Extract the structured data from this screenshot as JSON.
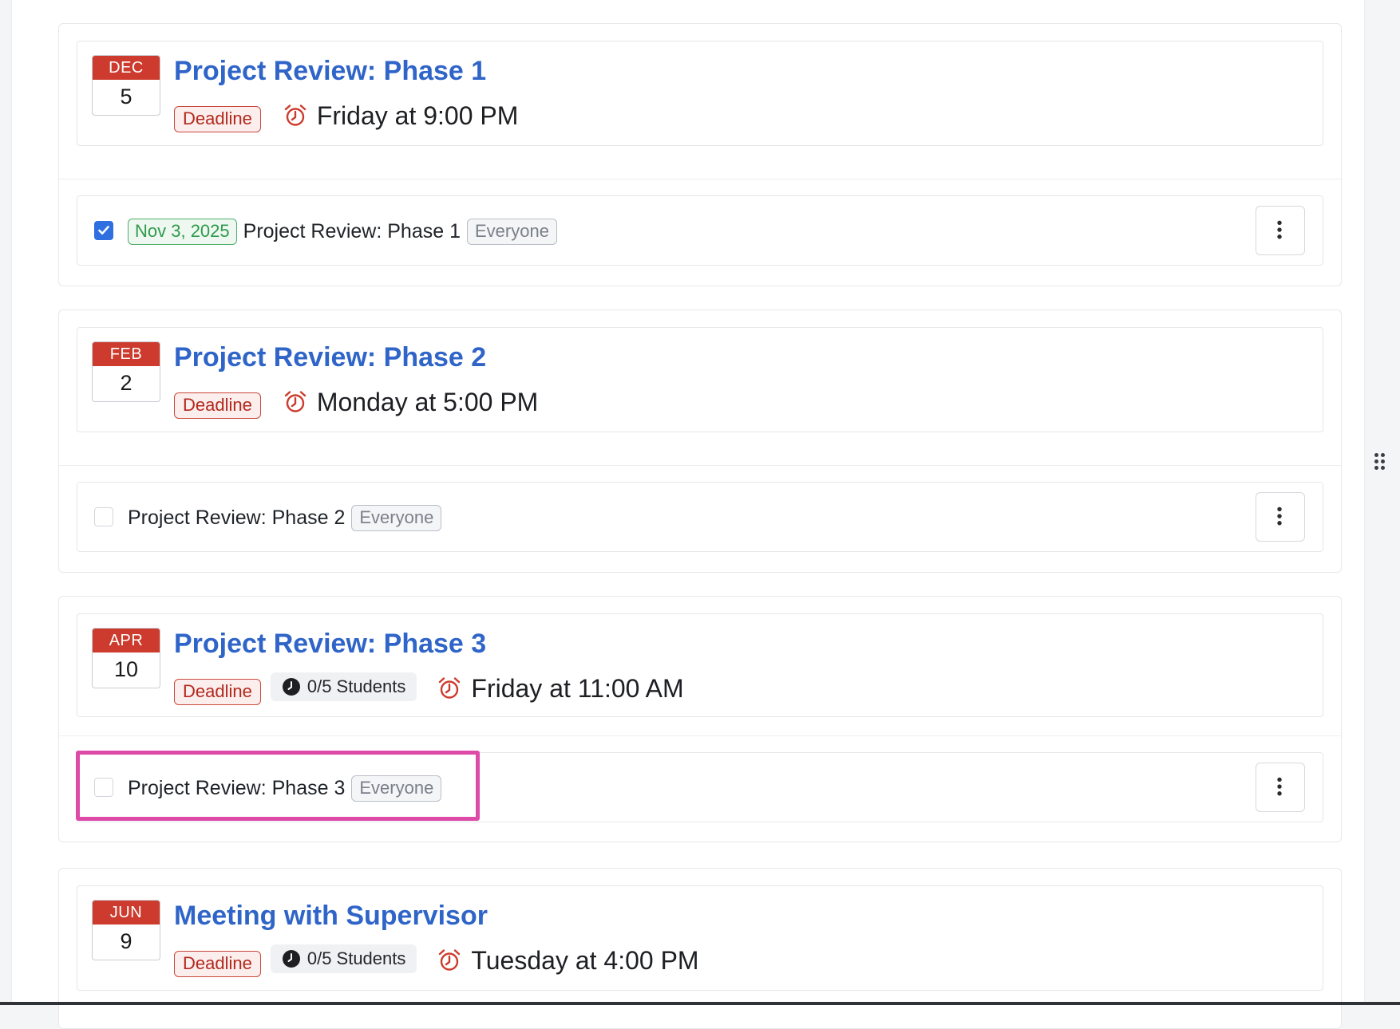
{
  "groups": [
    {
      "event": {
        "month": "DEC",
        "day": "5",
        "title": "Project Review: Phase 1",
        "deadline_label": "Deadline",
        "time": "Friday at 9:00 PM"
      },
      "task": {
        "checked": true,
        "date": "Nov 3, 2025",
        "title": "Project Review: Phase 1",
        "audience": "Everyone"
      }
    },
    {
      "event": {
        "month": "FEB",
        "day": "2",
        "title": "Project Review: Phase 2",
        "deadline_label": "Deadline",
        "time": "Monday at 5:00 PM"
      },
      "task": {
        "checked": false,
        "title": "Project Review: Phase 2",
        "audience": "Everyone"
      }
    },
    {
      "event": {
        "month": "APR",
        "day": "10",
        "title": "Project Review: Phase 3",
        "deadline_label": "Deadline",
        "students": "0/5 Students",
        "time": "Friday at 11:00 AM"
      },
      "task": {
        "checked": false,
        "title": "Project Review: Phase 3",
        "audience": "Everyone",
        "highlighted": true
      }
    },
    {
      "event": {
        "month": "JUN",
        "day": "9",
        "title": "Meeting with Supervisor",
        "deadline_label": "Deadline",
        "students": "0/5 Students",
        "time": "Tuesday at 4:00 PM"
      }
    }
  ],
  "colors": {
    "accent_blue": "#2f64c8",
    "calendar_red": "#cc3b2d",
    "deadline_red": "#b3281d",
    "date_green": "#2e9a4b",
    "highlight_pink": "#dd4aa8",
    "checkbox_blue": "#2f6fe0"
  },
  "icons": {
    "alarm": "alarm-clock-icon",
    "students": "clock-icon",
    "menu": "kebab-menu-icon",
    "check": "check-icon",
    "drag": "drag-handle-icon"
  }
}
